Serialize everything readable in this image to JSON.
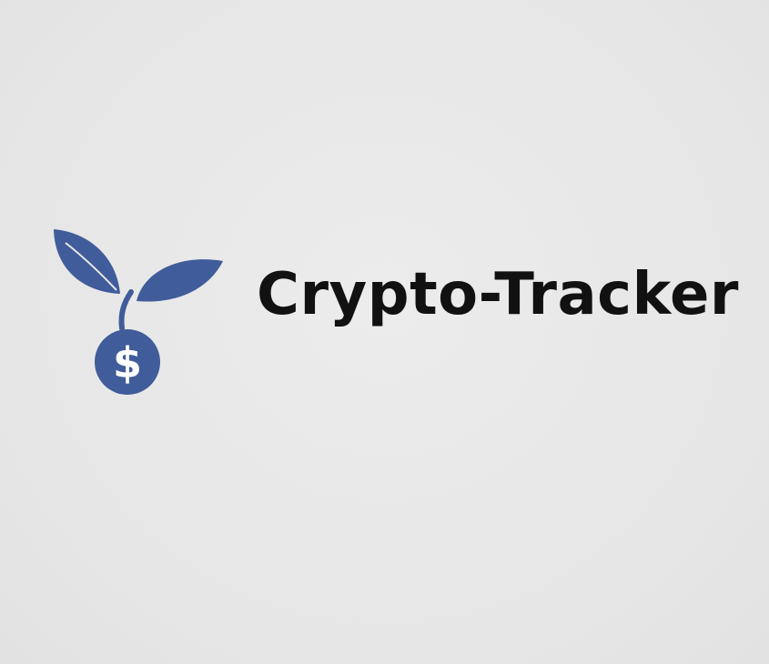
{
  "logo": {
    "wordmark": "Crypto-Tracker",
    "icon": "sprout-dollar-coin-icon",
    "coin_symbol": "$",
    "brand_color": "#405c9a",
    "text_color": "#111111",
    "background_color": "#e8e8e8"
  }
}
